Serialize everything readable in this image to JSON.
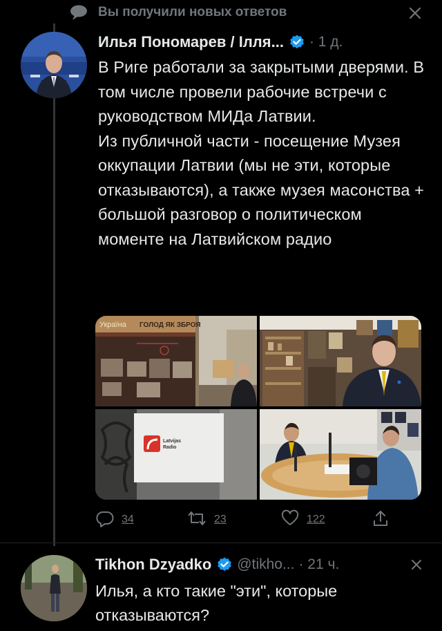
{
  "notification": {
    "text": "Вы получили новых ответов",
    "bubble_icon": "chat-bubble-icon",
    "close_icon": "close-icon"
  },
  "tweet1": {
    "author": "Илья Пономарев / Ілля...",
    "verified": true,
    "time": "· 1 д.",
    "text": "В Риге работали за закрытыми дверями. В том числе провели рабочие встречи с руководством МИДа Латвии.\nИз публичной части - посещение Музея оккупации Латвии (мы не эти, которые отказываются), а также музея масонства + большой разговор о политическом моменте на Латвийском радио",
    "photos": {
      "p1_sign_left": "Україна",
      "p1_sign_right": "ГОЛОД ЯК ЗБРОЯ",
      "p3_logo_line1": "Latvijas",
      "p3_logo_line2": "Radio"
    },
    "stats": {
      "replies": "34",
      "retweets": "23",
      "likes": "122"
    }
  },
  "tweet2": {
    "author": "Tikhon Dzyadko",
    "verified": true,
    "handle": "@tikho...",
    "time": "· 21 ч.",
    "text": "Илья, а кто такие \"эти\", которые отказываются?"
  },
  "colors": {
    "background": "#000000",
    "text_primary": "#e7e9ea",
    "text_secondary": "#71767b",
    "verified_blue": "#1d9bf0",
    "thread_line": "#333639"
  }
}
